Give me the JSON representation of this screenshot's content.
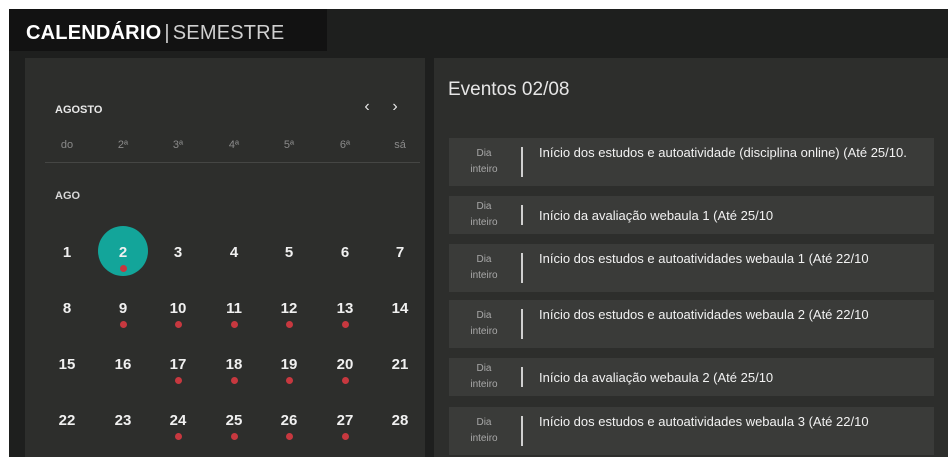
{
  "header": {
    "title_bold": "CALENDÁRIO",
    "separator": "|",
    "title_light": "SEMESTRE"
  },
  "calendar": {
    "month_label": "AGOSTO",
    "prev_icon": "‹",
    "next_icon": "›",
    "weekdays": [
      "do",
      "2ª",
      "3ª",
      "4ª",
      "5ª",
      "6ª",
      "sá"
    ],
    "section_label": "AGO",
    "weeks": [
      [
        {
          "d": "1",
          "dot": false
        },
        {
          "d": "2",
          "dot": true,
          "selected": true
        },
        {
          "d": "3",
          "dot": false
        },
        {
          "d": "4",
          "dot": false
        },
        {
          "d": "5",
          "dot": false
        },
        {
          "d": "6",
          "dot": false
        },
        {
          "d": "7",
          "dot": false
        }
      ],
      [
        {
          "d": "8",
          "dot": false
        },
        {
          "d": "9",
          "dot": true
        },
        {
          "d": "10",
          "dot": true
        },
        {
          "d": "11",
          "dot": true
        },
        {
          "d": "12",
          "dot": true
        },
        {
          "d": "13",
          "dot": true
        },
        {
          "d": "14",
          "dot": false
        }
      ],
      [
        {
          "d": "15",
          "dot": false
        },
        {
          "d": "16",
          "dot": false
        },
        {
          "d": "17",
          "dot": true
        },
        {
          "d": "18",
          "dot": true
        },
        {
          "d": "19",
          "dot": true
        },
        {
          "d": "20",
          "dot": true
        },
        {
          "d": "21",
          "dot": false
        }
      ],
      [
        {
          "d": "22",
          "dot": false
        },
        {
          "d": "23",
          "dot": false
        },
        {
          "d": "24",
          "dot": true
        },
        {
          "d": "25",
          "dot": true
        },
        {
          "d": "26",
          "dot": true
        },
        {
          "d": "27",
          "dot": true
        },
        {
          "d": "28",
          "dot": false
        }
      ]
    ]
  },
  "events": {
    "title": "Eventos 02/08",
    "items": [
      {
        "time_line1": "Dia",
        "time_line2": "inteiro",
        "text": "Início dos estudos e autoatividade (disciplina online) (Até 25/10."
      },
      {
        "time_line1": "Dia",
        "time_line2": "inteiro",
        "text": "Início da avaliação webaula 1 (Até 25/10"
      },
      {
        "time_line1": "Dia",
        "time_line2": "inteiro",
        "text": "Início dos estudos e autoatividades webaula 1 (Até 22/10"
      },
      {
        "time_line1": "Dia",
        "time_line2": "inteiro",
        "text": "Início dos estudos e autoatividades webaula 2 (Até 22/10"
      },
      {
        "time_line1": "Dia",
        "time_line2": "inteiro",
        "text": "Início da avaliação webaula 2 (Até 25/10"
      },
      {
        "time_line1": "Dia",
        "time_line2": "inteiro",
        "text": "Início dos estudos e autoatividades webaula 3 (Até 22/10"
      }
    ]
  },
  "colors": {
    "accent": "#13a59a",
    "event_dot": "#c7383f",
    "panel": "#2d2e2c",
    "background": "#1e1f1e"
  }
}
